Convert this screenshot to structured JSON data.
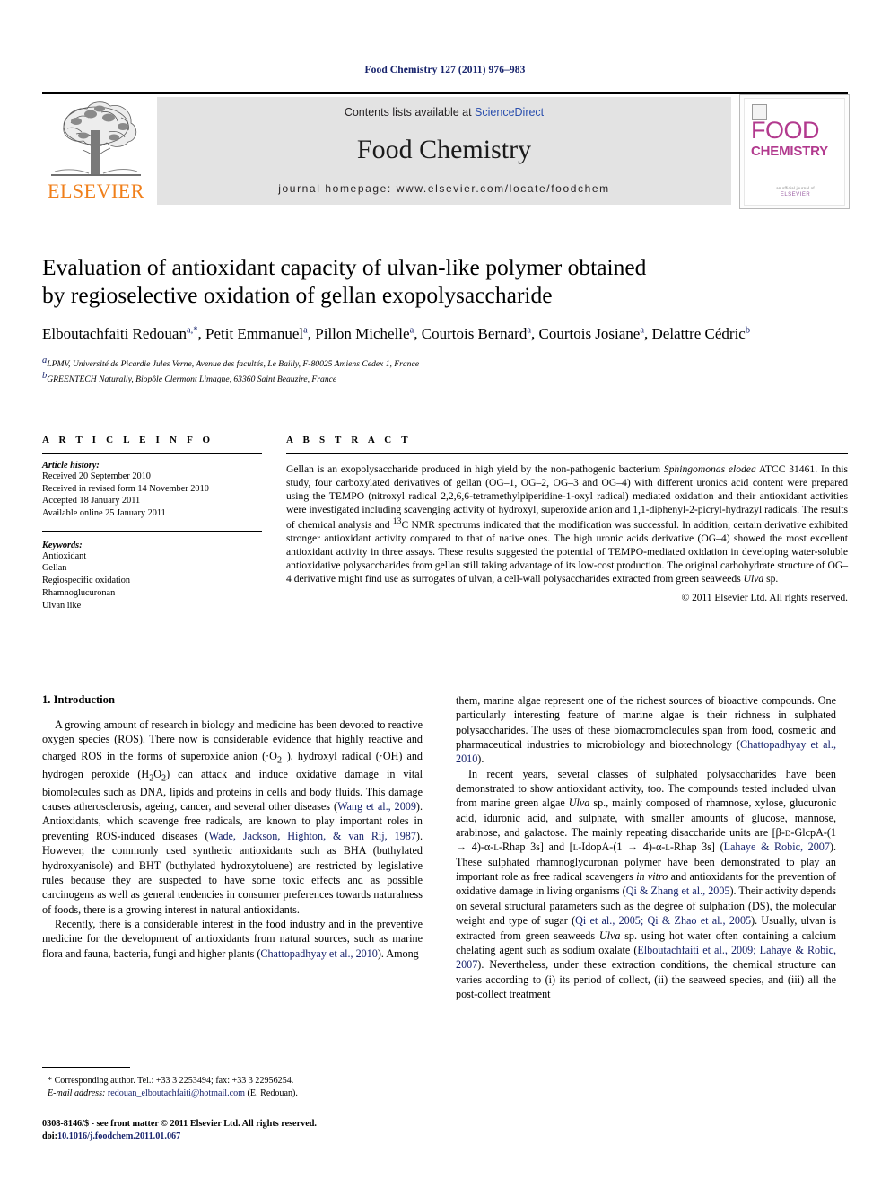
{
  "running_head": "Food Chemistry 127 (2011) 976–983",
  "masthead": {
    "publisher_name": "ELSEVIER",
    "contents_prefix": "Contents lists available at ",
    "contents_link": "ScienceDirect",
    "journal_title": "Food Chemistry",
    "homepage": "journal homepage: www.elsevier.com/locate/foodchem",
    "cover": {
      "word1": "FOOD",
      "word2": "CHEMISTRY",
      "footer_small": "an official journal of",
      "footer_org": "ELSEVIER"
    }
  },
  "article": {
    "title_line1": "Evaluation of antioxidant capacity of ulvan-like polymer obtained",
    "title_line2": "by regioselective oxidation of gellan exopolysaccharide",
    "authors_html": "Elboutachfaiti Redouan<sup>a,*</sup>, Petit Emmanuel<sup>a</sup>, Pillon Michelle<sup>a</sup>, Courtois Bernard<sup>a</sup>, Courtois Josiane<sup>a</sup>, Delattre Cédric<sup>b</sup>",
    "affiliation_a": "LPMV, Université de Picardie Jules Verne, Avenue des facultés, Le Bailly, F-80025 Amiens Cedex 1, France",
    "affiliation_b": "GREENTECH Naturally, Biopôle Clermont Limagne, 63360 Saint Beauzire, France"
  },
  "info": {
    "heading": "A R T I C L E   I N F O",
    "history_label": "Article history:",
    "history": [
      "Received 20 September 2010",
      "Received in revised form 14 November 2010",
      "Accepted 18 January 2011",
      "Available online 25 January 2011"
    ],
    "keywords_label": "Keywords:",
    "keywords": [
      "Antioxidant",
      "Gellan",
      "Regiospecific oxidation",
      "Rhamnoglucuronan",
      "Ulvan like"
    ]
  },
  "abstract": {
    "heading": "A B S T R A C T",
    "text_html": "Gellan is an exopolysaccharide produced in high yield by the non-pathogenic bacterium <i>Sphingomonas elodea</i> ATCC 31461. In this study, four carboxylated derivatives of gellan (OG–1, OG–2, OG–3 and OG–4) with different uronics acid content were prepared using the TEMPO (nitroxyl radical 2,2,6,6-tetramethylpiperidine-1-oxyl radical) mediated oxidation and their antioxidant activities were investigated including scavenging activity of hydroxyl, superoxide anion and 1,1-diphenyl-2-picryl-hydrazyl radicals. The results of chemical analysis and <sup>13</sup>C NMR spectrums indicated that the modification was successful. In addition, certain derivative exhibited stronger antioxidant activity compared to that of native ones. The high uronic acids derivative (OG–4) showed the most excellent antioxidant activity in three assays. These results suggested the potential of TEMPO-mediated oxidation in developing water-soluble antioxidative polysaccharides from gellan still taking advantage of its low-cost production. The original carbohydrate structure of OG–4 derivative might find use as surrogates of ulvan, a cell-wall polysaccharides extracted from green seaweeds <i>Ulva</i> sp.",
    "copyright": "© 2011 Elsevier Ltd. All rights reserved."
  },
  "body": {
    "section_heading": "1. Introduction",
    "left_paragraphs_html": [
      "A growing amount of research in biology and medicine has been devoted to reactive oxygen species (ROS). There now is considerable evidence that highly reactive and charged ROS in the forms of superoxide anion (·O<sub>2</sub><sup>−</sup>), hydroxyl radical (·OH) and hydrogen peroxide (H<sub>2</sub>O<sub>2</sub>) can attack and induce oxidative damage in vital biomolecules such as DNA, lipids and proteins in cells and body fluids. This damage causes atherosclerosis, ageing, cancer, and several other diseases (<span class=\"ref\">Wang et al., 2009</span>). Antioxidants, which scavenge free radicals, are known to play important roles in preventing ROS-induced diseases (<span class=\"ref\">Wade, Jackson, Highton, &amp; van Rij, 1987</span>). However, the commonly used synthetic antioxidants such as BHA (buthylated hydroxyanisole) and BHT (buthylated hydroxytoluene) are restricted by legislative rules because they are suspected to have some toxic effects and as possible carcinogens as well as general tendencies in consumer preferences towards naturalness of foods, there is a growing interest in natural antioxidants.",
      "Recently, there is a considerable interest in the food industry and in the preventive medicine for the development of antioxidants from natural sources, such as marine flora and fauna, bacteria, fungi and higher plants (<span class=\"ref\">Chattopadhyay et al., 2010</span>). Among"
    ],
    "right_paragraphs_html": [
      "them, marine algae represent one of the richest sources of bioactive compounds. One particularly interesting feature of marine algae is their richness in sulphated polysaccharides. The uses of these biomacromolecules span from food, cosmetic and pharmaceutical industries to microbiology and biotechnology (<span class=\"ref\">Chattopadhyay et al., 2010</span>).",
      "In recent years, several classes of sulphated polysaccharides have been demonstrated to show antioxidant activity, too. The compounds tested included ulvan from marine green algae <i>Ulva</i> sp., mainly composed of rhamnose, xylose, glucuronic acid, iduronic acid, and sulphate, with smaller amounts of glucose, mannose, arabinose, and galactose. The mainly repeating disaccharide units are [β-<span class=\"sc\">d</span>-GlcpA-(1 → 4)-α-<span class=\"sc\">l</span>-Rhap 3s] and [<span class=\"sc\">l</span>-IdopA-(1 → 4)-α-<span class=\"sc\">l</span>-Rhap 3s] (<span class=\"ref\">Lahaye &amp; Robic, 2007</span>). These sulphated rhamnoglycuronan polymer have been demonstrated to play an important role as free radical scavengers <i>in vitro</i> and antioxidants for the prevention of oxidative damage in living organisms (<span class=\"ref\">Qi &amp; Zhang et al., 2005</span>). Their activity depends on several structural parameters such as the degree of sulphation (DS), the molecular weight and type of sugar (<span class=\"ref\">Qi et al., 2005; Qi &amp; Zhao et al., 2005</span>). Usually, ulvan is extracted from green seaweeds <i>Ulva</i> sp. using hot water often containing a calcium chelating agent such as sodium oxalate (<span class=\"ref\">Elboutachfaiti et al., 2009; Lahaye &amp; Robic, 2007</span>). Nevertheless, under these extraction conditions, the chemical structure can varies according to (i) its period of collect, (ii) the seaweed species, and (iii) all the post-collect treatment"
    ]
  },
  "footnote": {
    "corresponding_html": "* Corresponding author. Tel.: +33 3 2253494; fax: +33 3 22956254.",
    "email_label": "E-mail address:",
    "email": "redouan_elboutachfaiti@hotmail.com",
    "email_suffix": "(E. Redouan)."
  },
  "imprint": {
    "line1": "0308-8146/$ - see front matter © 2011 Elsevier Ltd. All rights reserved.",
    "doi_label": "doi:",
    "doi": "10.1016/j.foodchem.2011.01.067"
  }
}
